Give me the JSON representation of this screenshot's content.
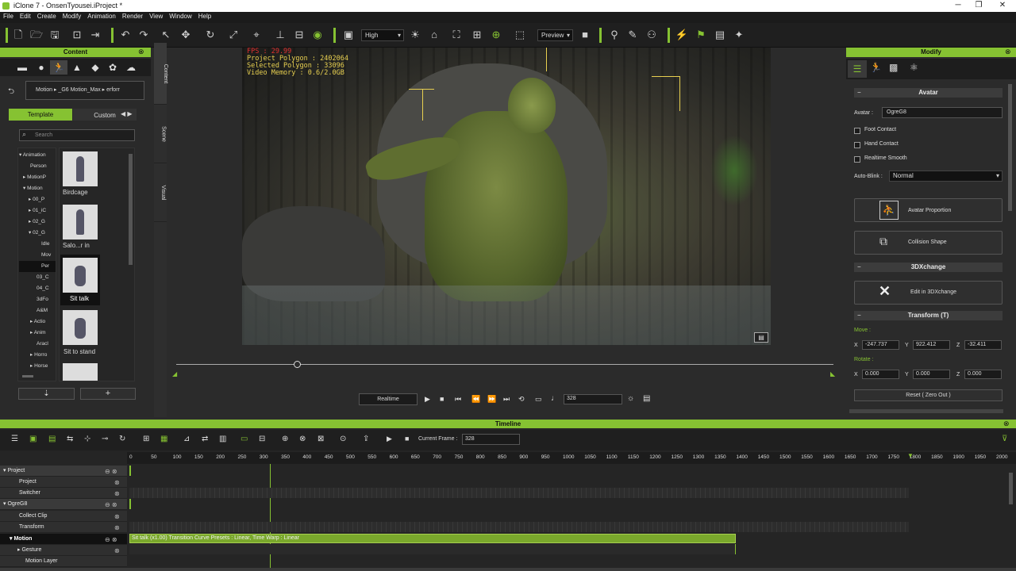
{
  "window": {
    "title": "iClone 7 - OnsenTyousei.iProject *"
  },
  "menu": [
    "File",
    "Edit",
    "Create",
    "Modify",
    "Animation",
    "Render",
    "View",
    "Window",
    "Help"
  ],
  "toolbar": {
    "quality": "High",
    "render_mode": "Preview"
  },
  "content_panel": {
    "title": "Content",
    "path": [
      "Motion",
      "_G6 Motion_Max",
      "erforr"
    ],
    "tabs": {
      "template": "Template",
      "custom": "Custom"
    },
    "search_placeholder": "Search",
    "tree": [
      "Animation",
      "Person",
      "MotionP",
      "Motion",
      "00_P",
      "01_iC",
      "02_G",
      "02_G",
      "Idle",
      "Mov",
      "Per",
      "03_C",
      "04_C",
      "3dFo",
      "A&M",
      "Actio",
      "Anim",
      "Aracl",
      "Horro",
      "Horse"
    ],
    "items": [
      "Birdcage",
      "Salo...r in",
      "Sit talk",
      "Sit to stand",
      ""
    ],
    "selected_item": "Sit talk"
  },
  "side_tabs": [
    "Content",
    "Scene",
    "Visual"
  ],
  "viewport": {
    "stats": [
      "FPS : 29.99",
      "Project Polygon : 2402064",
      "Selected Polygon : 33096",
      "Video Memory : 0.6/2.0GB"
    ]
  },
  "playback": {
    "mode": "Realtime",
    "frame": "328"
  },
  "modify_panel": {
    "title": "Modify",
    "avatar_section": "Avatar",
    "avatar_label": "Avatar :",
    "avatar_name": "OgreG8",
    "options": [
      "Foot Contact",
      "Hand Contact",
      "Realtime Smooth"
    ],
    "auto_blink_label": "Auto-Blink :",
    "auto_blink": "Normal",
    "avatar_proportion": "Avatar Proportion",
    "collision_shape": "Collision Shape",
    "xchange_section": "3DXchange",
    "edit_3dx": "Edit in 3DXchange",
    "transform_section": "Transform  (T)",
    "move_label": "Move :",
    "move": {
      "x": "-247.737",
      "y": "922.412",
      "z": "-32.411"
    },
    "rotate_label": "Rotate :",
    "rotate": {
      "x": "0.000",
      "y": "0.000",
      "z": "0.000"
    },
    "reset": "Reset ( Zero Out )"
  },
  "timeline": {
    "title": "Timeline",
    "current_frame_label": "Current Frame :",
    "current_frame": "328",
    "ticks": [
      "0",
      "50",
      "100",
      "150",
      "200",
      "250",
      "300",
      "350",
      "400",
      "450",
      "500",
      "550",
      "600",
      "650",
      "700",
      "750",
      "800",
      "850",
      "900",
      "950",
      "1000",
      "1050",
      "1100",
      "1150",
      "1200",
      "1250",
      "1300",
      "1350",
      "1400",
      "1450",
      "1500",
      "1550",
      "1600",
      "1650",
      "1700",
      "1750",
      "1800",
      "1850",
      "1900",
      "1950",
      "2000"
    ],
    "tracks": [
      "Project",
      "Project",
      "Switcher",
      "OgreG8",
      "Collect Clip",
      "Transform",
      "Motion",
      "Gesture",
      "Motion Layer"
    ],
    "clip_label": "Sit talk (x1.00) Transition Curve Presets : Linear, Time Warp : Linear"
  },
  "colors": {
    "accent": "#86c232",
    "overlay_text": "#e8d050"
  }
}
